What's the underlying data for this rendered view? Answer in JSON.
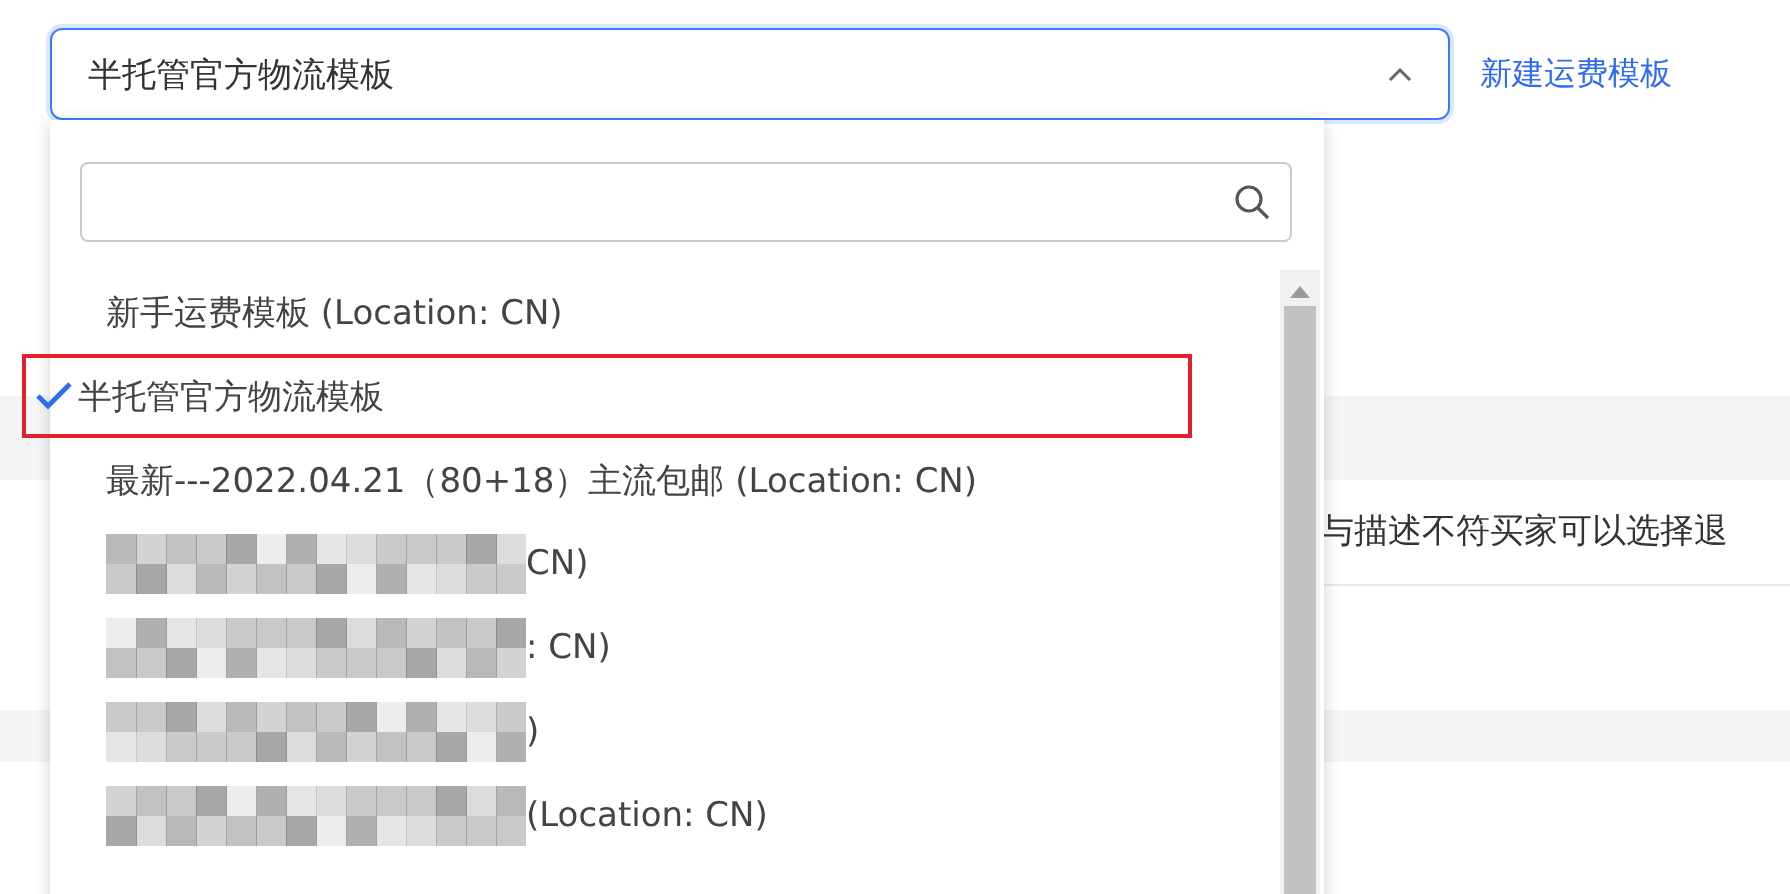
{
  "select": {
    "value": "半托管官方物流模板",
    "expanded": true
  },
  "link": "新建运费模板",
  "background": {
    "cell_fragment": "与描述不符买家可以选择退"
  },
  "dropdown": {
    "options": [
      {
        "kind": "text",
        "label": "新手运费模板 (Location: CN)",
        "selected": false
      },
      {
        "kind": "text",
        "label": "半托管官方物流模板",
        "selected": true
      },
      {
        "kind": "text",
        "label": "最新---2022.04.21（80+18）主流包邮 (Location: CN)",
        "selected": false
      },
      {
        "kind": "redacted",
        "label": "CN)",
        "selected": false
      },
      {
        "kind": "redacted",
        "label": ": CN)",
        "selected": false
      },
      {
        "kind": "redacted",
        "label": ")",
        "selected": false
      },
      {
        "kind": "redacted",
        "label": "(Location: CN)",
        "selected": false
      }
    ]
  }
}
